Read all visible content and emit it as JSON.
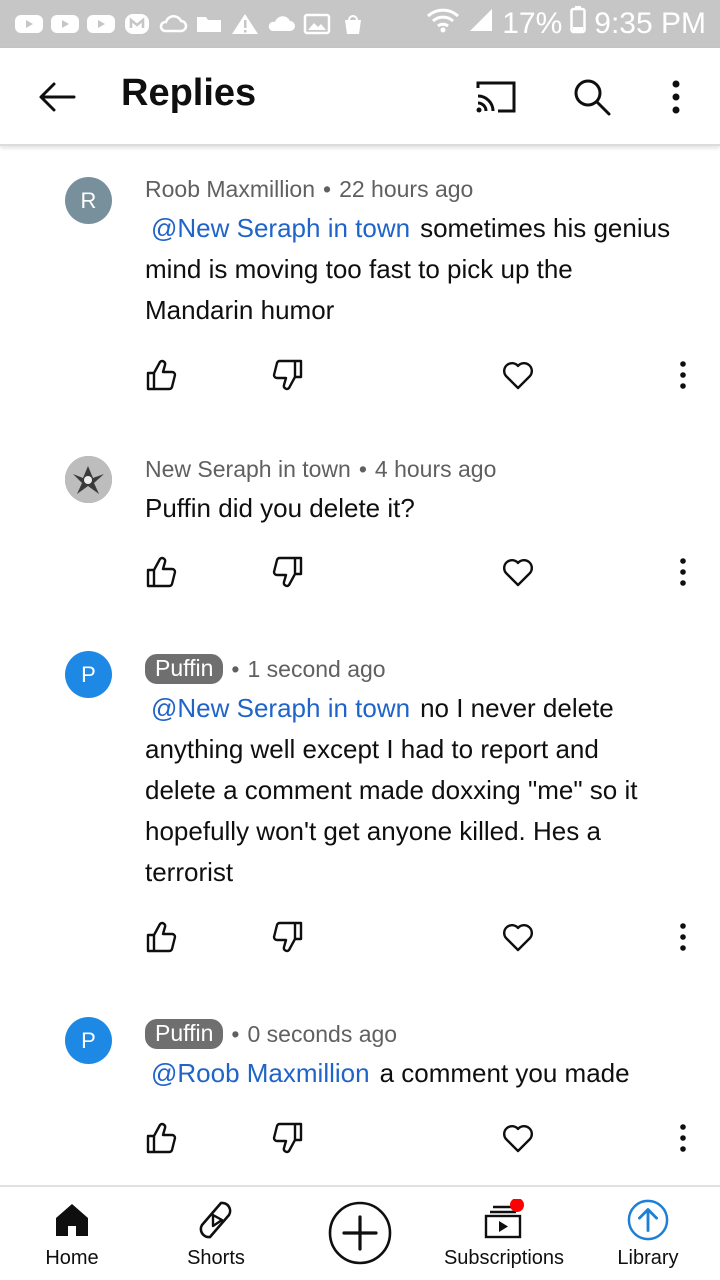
{
  "status_bar": {
    "battery": "17%",
    "time": "9:35 PM"
  },
  "header": {
    "title": "Replies",
    "icons": [
      "back-arrow-icon",
      "cast-icon",
      "search-icon",
      "more-vert-icon"
    ]
  },
  "comments": [
    {
      "avatar_letter": "R",
      "avatar_color": "#78909c",
      "author": "Roob Maxmillion",
      "time": "22 hours ago",
      "mention": "@New Seraph in town",
      "text": "sometimes his genius mind is moving too fast to pick up the Mandarin humor"
    },
    {
      "avatar_letter": "",
      "avatar_color": "#9e9e9e",
      "author": "New Seraph in town",
      "time": "4 hours ago",
      "mention": "",
      "text": "Puffin did you delete it?"
    },
    {
      "avatar_letter": "P",
      "avatar_color": "#1e88e5",
      "author": "Puffin",
      "time": "1 second ago",
      "mention": "@New Seraph in town",
      "text": "no I never delete anything well except I had to report and delete a comment made doxxing \"me\" so it hopefully won't get anyone killed. Hes a terrorist"
    },
    {
      "avatar_letter": "P",
      "avatar_color": "#1e88e5",
      "author": "Puffin",
      "time": "0 seconds ago",
      "mention": "@Roob Maxmillion",
      "text": "a comment you made"
    }
  ],
  "separator": "•",
  "bottom_nav": {
    "home": "Home",
    "shorts": "Shorts",
    "subscriptions": "Subscriptions",
    "library": "Library"
  },
  "colors": {
    "link": "#1f64c8",
    "badge": "#6f6f6f",
    "notification_dot": "#ff0000",
    "library_accent": "#1e7fd6"
  }
}
